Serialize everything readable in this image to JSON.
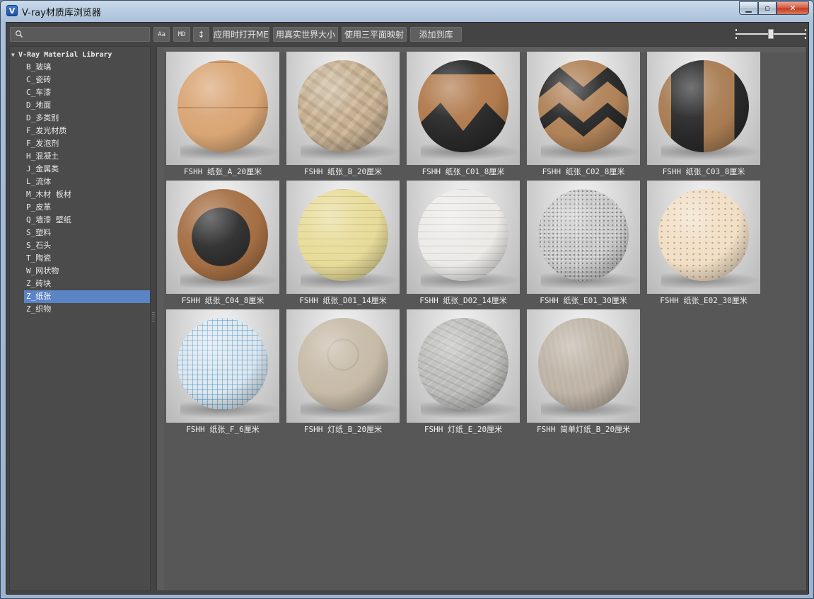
{
  "window": {
    "title": "V-ray材质库浏览器",
    "app_icon_glyph": "V",
    "minimize_glyph": "▁",
    "maximize_glyph": "▫",
    "close_glyph": "✕"
  },
  "toolbar": {
    "search_placeholder": "",
    "search_value": "",
    "buttons": [
      {
        "label": "Aa",
        "icon": "font-case-icon"
      },
      {
        "label": "MD",
        "icon": "md-icon"
      },
      {
        "label": "↕",
        "icon": "sort-icon"
      },
      {
        "label": "应用时打开ME"
      },
      {
        "label": "用真实世界大小"
      },
      {
        "label": "使用三平面映射"
      },
      {
        "label": "添加到库"
      }
    ],
    "zoom_level": 0.5
  },
  "tree": {
    "root_label": "V-Ray Material Library",
    "expander_glyph": "▼",
    "items": [
      "B_玻璃",
      "C_瓷砖",
      "C_车漆",
      "D_地面",
      "D_多类别",
      "F_发光材质",
      "F_发泡剂",
      "H_混凝土",
      "J_金属类",
      "L_流体",
      "M_木材 板材",
      "P_皮革",
      "Q_墙漆 壁纸",
      "S_塑料",
      "S_石头",
      "T_陶瓷",
      "W_网状物",
      "Z_砖块",
      "Z_纸张",
      "Z_织物"
    ],
    "selected_index": 18
  },
  "materials": [
    {
      "label": "FSHH 纸张_A_20厘米",
      "color": "#d9a574"
    },
    {
      "label": "FSHH 纸张_B_20厘米",
      "color": "#c9b190"
    },
    {
      "label": "FSHH 纸张_C01_8厘米",
      "color": "#b07a4c"
    },
    {
      "label": "FSHH 纸张_C02_8厘米",
      "color": "#b08258"
    },
    {
      "label": "FSHH 纸张_C03_8厘米",
      "color": "#a87c52"
    },
    {
      "label": "FSHH 纸张_C04_8厘米",
      "color": "#a56f44"
    },
    {
      "label": "FSHH 纸张_D01_14厘米",
      "color": "#e8dc9b"
    },
    {
      "label": "FSHH 纸张_D02_14厘米",
      "color": "#ecebe8"
    },
    {
      "label": "FSHH 纸张_E01_30厘米",
      "color": "#c8c8c8"
    },
    {
      "label": "FSHH 纸张_E02_30厘米",
      "color": "#f1dfc6"
    },
    {
      "label": "FSHH 纸张_F_6厘米",
      "color": "#dfe7ee"
    },
    {
      "label": "FSHH 灯纸_B_20厘米",
      "color": "#c7bba8"
    },
    {
      "label": "FSHH 灯纸_E_20厘米",
      "color": "#bdbdbb"
    },
    {
      "label": "FSHH 简单灯纸_B_20厘米",
      "color": "#bdb2a4"
    }
  ],
  "colors": {
    "selection": "#5a84c4",
    "panel_bg": "#4b4b4b",
    "grid_bg": "#575757"
  }
}
